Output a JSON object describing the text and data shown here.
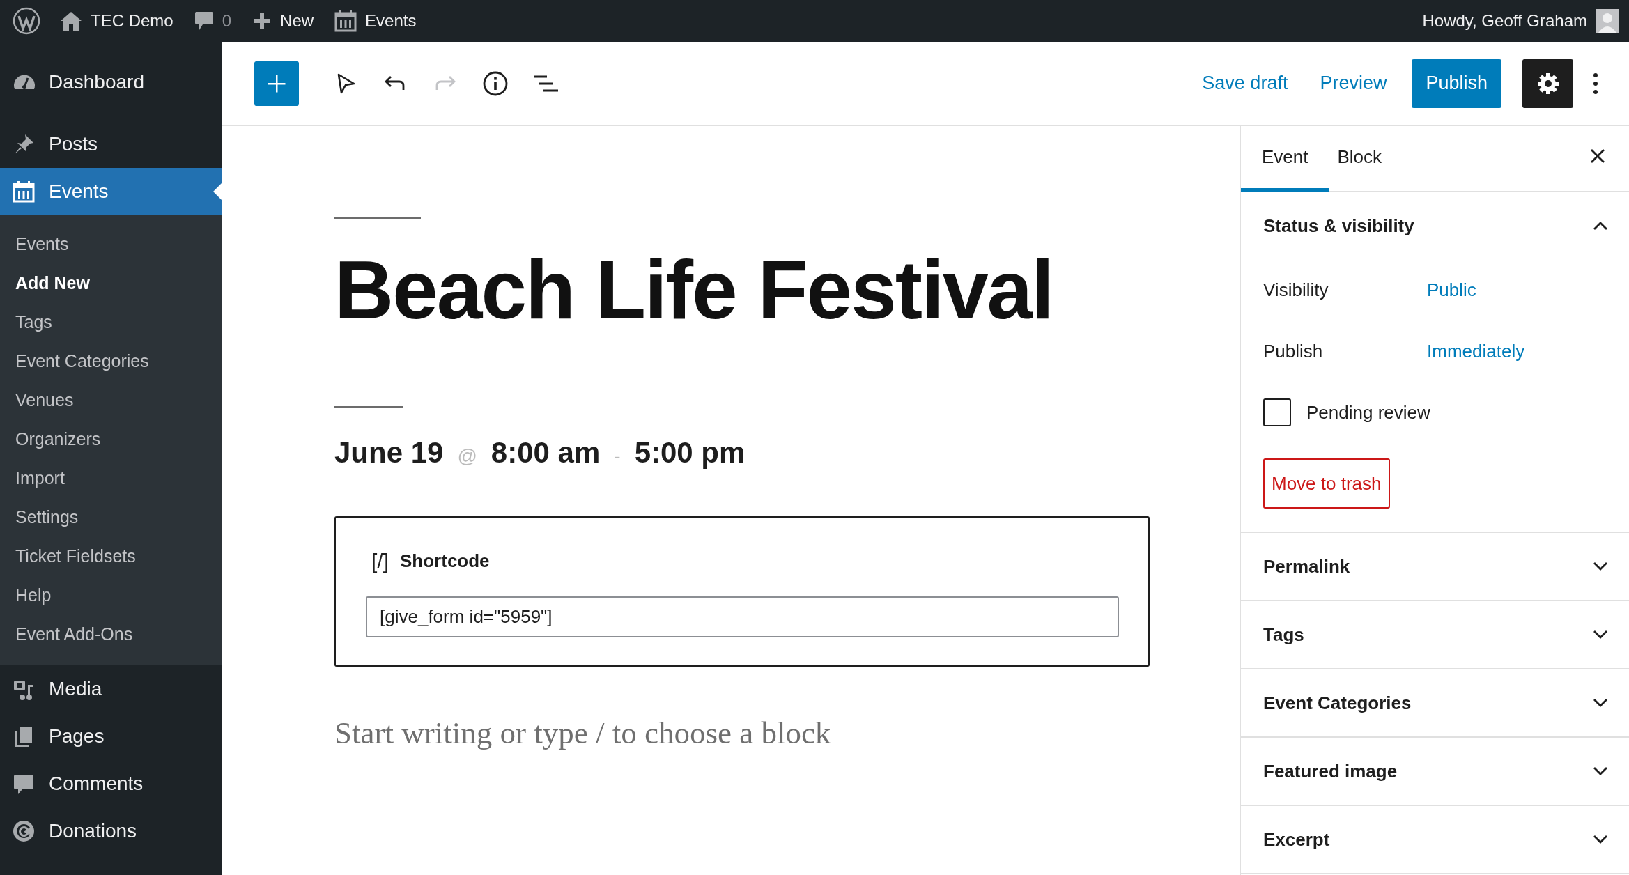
{
  "admin_bar": {
    "site": "TEC Demo",
    "comments": "0",
    "new": "New",
    "events": "Events",
    "greeting": "Howdy, Geoff Graham"
  },
  "sidebar": {
    "items": [
      {
        "label": "Dashboard",
        "selected": false
      },
      {
        "label": "Posts",
        "selected": false
      },
      {
        "label": "Events",
        "selected": true,
        "children": [
          {
            "label": "Events",
            "selected": false
          },
          {
            "label": "Add New",
            "selected": true
          },
          {
            "label": "Tags",
            "selected": false
          },
          {
            "label": "Event Categories",
            "selected": false
          },
          {
            "label": "Venues",
            "selected": false
          },
          {
            "label": "Organizers",
            "selected": false
          },
          {
            "label": "Import",
            "selected": false
          },
          {
            "label": "Settings",
            "selected": false
          },
          {
            "label": "Ticket Fieldsets",
            "selected": false
          },
          {
            "label": "Help",
            "selected": false
          },
          {
            "label": "Event Add-Ons",
            "selected": false
          }
        ]
      },
      {
        "label": "Media",
        "selected": false
      },
      {
        "label": "Pages",
        "selected": false
      },
      {
        "label": "Comments",
        "selected": false
      },
      {
        "label": "Donations",
        "selected": false
      }
    ]
  },
  "toolbar": {
    "tools": [
      {
        "disabled": false
      },
      {
        "disabled": false
      },
      {
        "disabled": true
      },
      {
        "disabled": false
      },
      {
        "disabled": false
      }
    ],
    "save_draft": "Save draft",
    "preview": "Preview",
    "publish": "Publish",
    "settings_selected": true
  },
  "editor": {
    "title": "Beach Life Festival",
    "date": "June 19",
    "at": "@",
    "start": "8:00 am",
    "dash": "-",
    "end": "5:00 pm",
    "shortcode": {
      "icon_text": "[/]",
      "label": "Shortcode",
      "value": "[give_form id=\"5959\"]"
    },
    "placeholder": "Start writing or type / to choose a block"
  },
  "settings_panel": {
    "tabs": [
      {
        "label": "Event",
        "selected": true
      },
      {
        "label": "Block",
        "selected": false
      }
    ],
    "sections": [
      {
        "title": "Status & visibility",
        "expanded": true,
        "rows": [
          {
            "label": "Visibility",
            "value": "Public"
          },
          {
            "label": "Publish",
            "value": "Immediately"
          }
        ],
        "pending_review": {
          "label": "Pending review",
          "checked": false
        },
        "trash": "Move to trash"
      },
      {
        "title": "Permalink",
        "expanded": false
      },
      {
        "title": "Tags",
        "expanded": false
      },
      {
        "title": "Event Categories",
        "expanded": false
      },
      {
        "title": "Featured image",
        "expanded": false
      },
      {
        "title": "Excerpt",
        "expanded": false
      }
    ]
  }
}
